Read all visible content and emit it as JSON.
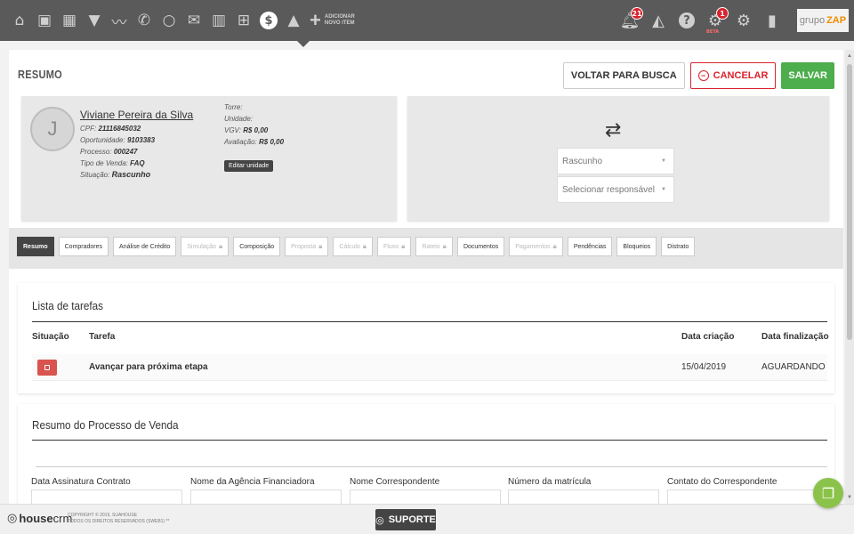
{
  "topbar": {
    "nav_icons": [
      "home-icon",
      "id-card-icon",
      "calendar-icon",
      "filter-icon",
      "chart-icon",
      "phone-icon",
      "chat-icon",
      "mail-icon",
      "building-icon",
      "grid-icon",
      "dollar-icon",
      "graduation-icon"
    ],
    "add_item_line1": "ADICIONAR",
    "add_item_line2": "NOVO ITEM",
    "notifications_count": "21",
    "beta_count": "1",
    "beta_label": "BETA",
    "logo_text1": "grupo",
    "logo_text2": "ZAP"
  },
  "header": {
    "title": "RESUMO",
    "back_label": "VOLTAR PARA BUSCA",
    "cancel_label": "CANCELAR",
    "save_label": "SALVAR"
  },
  "client": {
    "avatar_initial": "J",
    "name": "Viviane Pereira da Silva",
    "cpf_label": "CPF:",
    "cpf": "21116845032",
    "opportunity_label": "Oportunidade:",
    "opportunity": "9103383",
    "process_label": "Processo:",
    "process": "000247",
    "sale_type_label": "Tipo de Venda:",
    "sale_type": "FAQ",
    "status_label": "Situação:",
    "status": "Rascunho",
    "tower_label": "Torre:",
    "unit_label": "Unidade:",
    "vgv_label": "VGV:",
    "vgv": "R$ 0,00",
    "evaluation_label": "Avaliação:",
    "evaluation": "R$ 0,00",
    "edit_unit_label": "Editar unidade"
  },
  "status_panel": {
    "status_select": "Rascunho",
    "responsible_placeholder": "Selecionar responsável"
  },
  "tabs": [
    {
      "label": "Resumo",
      "state": "active"
    },
    {
      "label": "Compradores",
      "state": "normal"
    },
    {
      "label": "Análise de Crédito",
      "state": "normal"
    },
    {
      "label": "Simulação",
      "state": "disabled"
    },
    {
      "label": "Composição",
      "state": "normal"
    },
    {
      "label": "Proposta",
      "state": "disabled"
    },
    {
      "label": "Cálculo",
      "state": "disabled"
    },
    {
      "label": "Fluxo",
      "state": "disabled"
    },
    {
      "label": "Rateio",
      "state": "disabled"
    },
    {
      "label": "Documentos",
      "state": "normal"
    },
    {
      "label": "Pagamentos",
      "state": "disabled"
    },
    {
      "label": "Pendências",
      "state": "normal"
    },
    {
      "label": "Bloqueios",
      "state": "normal"
    },
    {
      "label": "Distrato",
      "state": "normal"
    }
  ],
  "tasks": {
    "title": "Lista de tarefas",
    "col_status": "Situação",
    "col_task": "Tarefa",
    "col_created": "Data criação",
    "col_finished": "Data finalização",
    "rows": [
      {
        "task": "Avançar para próxima etapa",
        "created": "15/04/2019",
        "finished": "AGUARDANDO"
      }
    ]
  },
  "summary": {
    "title": "Resumo do Processo de Venda",
    "fields": [
      "Data Assinatura Contrato",
      "Nome da Agência Financiadora",
      "Nome Correspondente",
      "Número da matrícula",
      "Contato do Correspondente"
    ]
  },
  "footer": {
    "brand1": "house",
    "brand2": "crm",
    "copyright1": "COPYRIGHT © 2019, SUAHOUSE",
    "copyright2": "TODOS OS DIREITOS RESERVADOS (SWEB1) **",
    "support_label": "SUPORTE"
  },
  "colors": {
    "topbar": "#5a5a5a",
    "danger": "#d9232d",
    "success": "#4cae4c",
    "chat": "#8bc34a"
  }
}
